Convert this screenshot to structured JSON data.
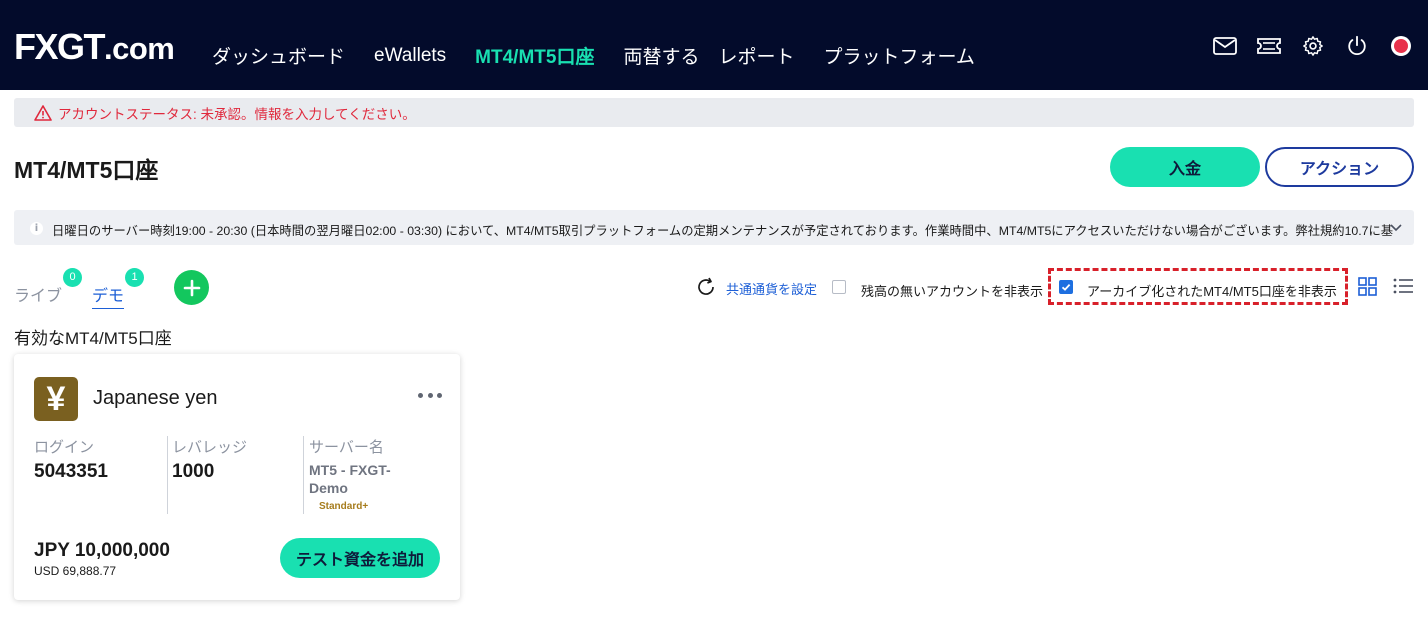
{
  "header": {
    "logo_main": "FXGT",
    "logo_suffix": ".com",
    "nav": [
      {
        "label": "ダッシュボード",
        "active": false
      },
      {
        "label": "eWallets",
        "active": false
      },
      {
        "label": "MT4/MT5口座",
        "active": true
      },
      {
        "label": "両替する",
        "active": false
      },
      {
        "label": "レポート",
        "active": false
      },
      {
        "label": "プラットフォーム",
        "active": false
      }
    ],
    "icons": [
      "mail-icon",
      "ticket-icon",
      "gear-icon",
      "power-icon",
      "recording-indicator"
    ]
  },
  "status": {
    "text": "アカウントステータス: 未承認。情報を入力してください。",
    "icon": "warning-icon",
    "color": "#e0283c"
  },
  "page": {
    "title": "MT4/MT5口座",
    "deposit_label": "入金",
    "action_label": "アクション"
  },
  "notice": {
    "text": "日曜日のサーバー時刻19:00 - 20:30 (日本時間の翌月曜日02:00 - 03:30) において、MT4/MT5取引プラットフォームの定期メンテナンスが予定されております。作業時間中、MT4/MT5にアクセスいただけない場合がございます。弊社規約10.7に基",
    "icon": "info-icon",
    "expand_icon": "chevron-down-icon"
  },
  "tabs": {
    "live_label": "ライブ",
    "live_count": "0",
    "demo_label": "デモ",
    "demo_count": "1",
    "add_icon": "plus-icon"
  },
  "filters": {
    "currency_link": "共通通貨を設定",
    "hide_zero_label": "残高の無いアカウントを非表示",
    "hide_zero_checked": false,
    "hide_archived_label": "アーカイブ化されたMT4/MT5口座を非表示",
    "hide_archived_checked": true
  },
  "section": {
    "label": "有効なMT4/MT5口座"
  },
  "account": {
    "currency_symbol": "¥",
    "name": "Japanese yen",
    "login_label": "ログイン",
    "login": "5043351",
    "leverage_label": "レバレッジ",
    "leverage": "1000",
    "server_label": "サーバー名",
    "server": "MT5 - FXGT-Demo",
    "account_type": "Standard+",
    "balance": "JPY 10,000,000",
    "balance_usd": "USD 69,888.77",
    "fund_label": "テスト資金を追加"
  },
  "colors": {
    "header_bg": "#030b2b",
    "accent": "#19e0b1",
    "link_blue": "#1d5fd6",
    "highlight_dash": "#d8202a"
  }
}
